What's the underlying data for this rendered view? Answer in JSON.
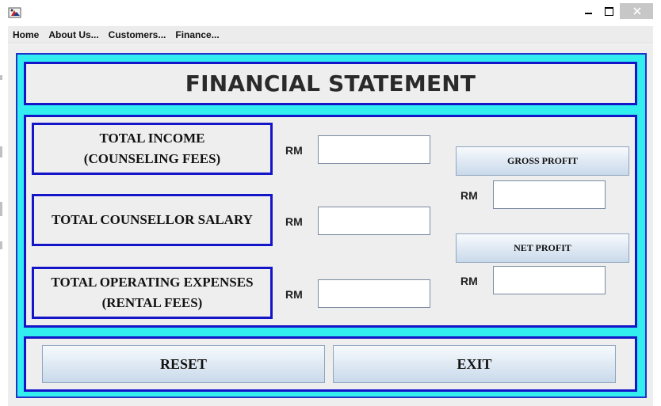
{
  "window": {
    "title": ""
  },
  "menu": {
    "items": [
      "Home",
      "About Us...",
      "Customers...",
      "Finance..."
    ]
  },
  "header": {
    "title": "FINANCIAL STATEMENT"
  },
  "form": {
    "rows": [
      {
        "label_line1": "TOTAL INCOME",
        "label_line2": "(COUNSELING FEES)",
        "currency": "RM",
        "value": ""
      },
      {
        "label_line1": "TOTAL COUNSELLOR SALARY",
        "label_line2": "",
        "currency": "RM",
        "value": ""
      },
      {
        "label_line1": "TOTAL OPERATING EXPENSES",
        "label_line2": "(RENTAL FEES)",
        "currency": "RM",
        "value": ""
      }
    ],
    "gross_profit": {
      "button_label": "GROSS PROFIT",
      "currency": "RM",
      "value": ""
    },
    "net_profit": {
      "button_label": "NET PROFIT",
      "currency": "RM",
      "value": ""
    }
  },
  "actions": {
    "reset_label": "RESET",
    "exit_label": "EXIT"
  },
  "colors": {
    "outer_panel": "#33eeee",
    "panel_border": "#1414c8",
    "panel_bg": "#eeeeee"
  },
  "icons": {
    "app": "java-app-icon",
    "minimize": "minimize-icon",
    "maximize": "maximize-icon",
    "close": "close-icon"
  }
}
